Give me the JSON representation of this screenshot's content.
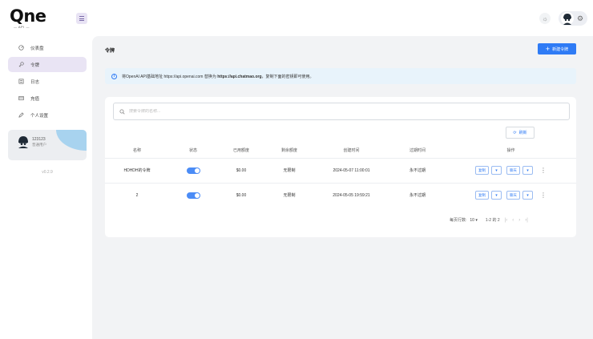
{
  "brand": {
    "name": "Qne",
    "sub": "— API —"
  },
  "sidebar": {
    "items": [
      {
        "label": "仪表盘",
        "icon": "dashboard-icon",
        "active": false
      },
      {
        "label": "令牌",
        "icon": "key-icon",
        "active": true
      },
      {
        "label": "日志",
        "icon": "log-icon",
        "active": false
      },
      {
        "label": "充值",
        "icon": "wallet-icon",
        "active": false
      },
      {
        "label": "个人设置",
        "icon": "pen-icon",
        "active": false
      }
    ],
    "user": {
      "name": "123123",
      "role": "普通用户"
    },
    "version": "v0.2.9"
  },
  "main": {
    "title": "令牌",
    "add_label": "新建令牌",
    "banner": {
      "prefix": "将OpenAI API基础地址 https://api.openai.com 替换为 ",
      "highlight": "https://api.chatmao.org",
      "suffix": "，复制下面的密钥即可使用。"
    },
    "search_placeholder": "搜索令牌的名称...",
    "refresh_label": "刷新",
    "table": {
      "headers": [
        "名称",
        "状态",
        "已用额度",
        "剩余额度",
        "创建时间",
        "过期时间",
        "操作"
      ],
      "rows": [
        {
          "name": "HDHDH的令牌",
          "enabled": true,
          "used": "$0.00",
          "remain": "无限制",
          "created": "2024-05-07 11:00:01",
          "expire": "永不过期",
          "op1": "复制",
          "op2": "聊天"
        },
        {
          "name": "2",
          "enabled": true,
          "used": "$0.00",
          "remain": "无限制",
          "created": "2024-05-05 19:59:21",
          "expire": "永不过期",
          "op1": "复制",
          "op2": "聊天"
        }
      ]
    },
    "pager": {
      "label": "每页行数:",
      "size": "10",
      "range": "1-2 的 2"
    }
  },
  "colors": {
    "accent": "#2f7bf5",
    "active_nav": "#e9e4f4",
    "banner": "#e8f3fb"
  }
}
